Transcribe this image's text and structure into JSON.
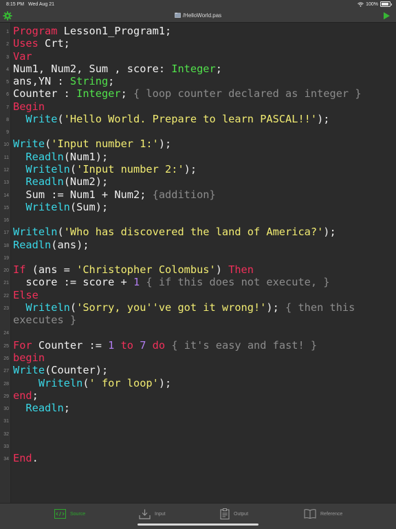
{
  "status": {
    "time": "8:15 PM",
    "date": "Wed Aug 21",
    "battery": "100%"
  },
  "toolbar": {
    "title": "/HelloWorld.pas",
    "settings_icon": "gear-icon",
    "run_icon": "play-icon"
  },
  "colors": {
    "keyword": "#f0305a",
    "function": "#3ad7e6",
    "type": "#51e14b",
    "string": "#f2ec72",
    "number": "#b07df0",
    "comment": "#8c8c8c",
    "accent": "#2ea82e"
  },
  "editor": {
    "lines": [
      {
        "n": "1",
        "segs": [
          [
            "kw",
            "Program"
          ],
          [
            "p",
            " Lesson1_Program1;"
          ]
        ]
      },
      {
        "n": "2",
        "segs": [
          [
            "kw",
            "Uses"
          ],
          [
            "p",
            " Crt;"
          ]
        ]
      },
      {
        "n": "3",
        "segs": [
          [
            "kw",
            "Var"
          ]
        ]
      },
      {
        "n": "4",
        "segs": [
          [
            "p",
            "Num1, Num2, Sum , score: "
          ],
          [
            "ty",
            "Integer"
          ],
          [
            "p",
            ";"
          ]
        ]
      },
      {
        "n": "5",
        "segs": [
          [
            "p",
            "ans,YN : "
          ],
          [
            "ty",
            "String"
          ],
          [
            "p",
            ";"
          ]
        ]
      },
      {
        "n": "6",
        "segs": [
          [
            "p",
            "Counter : "
          ],
          [
            "ty",
            "Integer"
          ],
          [
            "p",
            "; "
          ],
          [
            "cm",
            "{ loop counter declared as integer }"
          ]
        ]
      },
      {
        "n": "7",
        "segs": [
          [
            "kw",
            "Begin"
          ]
        ]
      },
      {
        "n": "8",
        "segs": [
          [
            "p",
            "  "
          ],
          [
            "fn",
            "Write"
          ],
          [
            "p",
            "("
          ],
          [
            "st",
            "'Hello World. Prepare to learn PASCAL!!'"
          ],
          [
            "p",
            ");"
          ]
        ]
      },
      {
        "n": "9",
        "segs": []
      },
      {
        "n": "10",
        "segs": [
          [
            "fn",
            "Write"
          ],
          [
            "p",
            "("
          ],
          [
            "st",
            "'Input number 1:'"
          ],
          [
            "p",
            ");"
          ]
        ]
      },
      {
        "n": "11",
        "segs": [
          [
            "p",
            "  "
          ],
          [
            "fn",
            "Readln"
          ],
          [
            "p",
            "(Num1);"
          ]
        ]
      },
      {
        "n": "12",
        "segs": [
          [
            "p",
            "  "
          ],
          [
            "fn",
            "Writeln"
          ],
          [
            "p",
            "("
          ],
          [
            "st",
            "'Input number 2:'"
          ],
          [
            "p",
            ");"
          ]
        ]
      },
      {
        "n": "13",
        "segs": [
          [
            "p",
            "  "
          ],
          [
            "fn",
            "Readln"
          ],
          [
            "p",
            "(Num2);"
          ]
        ]
      },
      {
        "n": "14",
        "segs": [
          [
            "p",
            "  Sum := Num1 + Num2; "
          ],
          [
            "cm",
            "{addition}"
          ]
        ]
      },
      {
        "n": "15",
        "segs": [
          [
            "p",
            "  "
          ],
          [
            "fn",
            "Writeln"
          ],
          [
            "p",
            "(Sum);"
          ]
        ]
      },
      {
        "n": "16",
        "segs": []
      },
      {
        "n": "17",
        "segs": [
          [
            "fn",
            "Writeln"
          ],
          [
            "p",
            "("
          ],
          [
            "st",
            "'Who has discovered the land of America?'"
          ],
          [
            "p",
            ");"
          ]
        ]
      },
      {
        "n": "18",
        "segs": [
          [
            "fn",
            "Readln"
          ],
          [
            "p",
            "(ans);"
          ]
        ]
      },
      {
        "n": "19",
        "segs": []
      },
      {
        "n": "20",
        "segs": [
          [
            "kw",
            "If"
          ],
          [
            "p",
            " (ans = "
          ],
          [
            "st",
            "'Christopher Colombus'"
          ],
          [
            "p",
            ") "
          ],
          [
            "kw",
            "Then"
          ]
        ]
      },
      {
        "n": "21",
        "segs": [
          [
            "p",
            "  score := score + "
          ],
          [
            "nm",
            "1"
          ],
          [
            "p",
            " "
          ],
          [
            "cm",
            "{ if this does not execute, }"
          ]
        ]
      },
      {
        "n": "22",
        "segs": [
          [
            "kw",
            "Else"
          ]
        ]
      },
      {
        "n": "23",
        "segs": [
          [
            "p",
            "  "
          ],
          [
            "fn",
            "Writeln"
          ],
          [
            "p",
            "("
          ],
          [
            "st",
            "'Sorry, you''ve got it wrong!'"
          ],
          [
            "p",
            "); "
          ],
          [
            "cm",
            "{ then this"
          ]
        ]
      },
      {
        "n": "",
        "segs": [
          [
            "cm",
            "executes }"
          ]
        ]
      },
      {
        "n": "24",
        "segs": []
      },
      {
        "n": "25",
        "segs": [
          [
            "kw",
            "For"
          ],
          [
            "p",
            " Counter := "
          ],
          [
            "nm",
            "1"
          ],
          [
            "p",
            " "
          ],
          [
            "kw",
            "to"
          ],
          [
            "p",
            " "
          ],
          [
            "nm",
            "7"
          ],
          [
            "p",
            " "
          ],
          [
            "kw",
            "do"
          ],
          [
            "p",
            " "
          ],
          [
            "cm",
            "{ it's easy and fast! }"
          ]
        ]
      },
      {
        "n": "26",
        "segs": [
          [
            "kw",
            "begin"
          ]
        ]
      },
      {
        "n": "27",
        "segs": [
          [
            "fn",
            "Write"
          ],
          [
            "p",
            "(Counter);"
          ]
        ]
      },
      {
        "n": "28",
        "segs": [
          [
            "p",
            "    "
          ],
          [
            "fn",
            "Writeln"
          ],
          [
            "p",
            "("
          ],
          [
            "st",
            "' for loop'"
          ],
          [
            "p",
            ");"
          ]
        ]
      },
      {
        "n": "29",
        "segs": [
          [
            "kw",
            "end"
          ],
          [
            "p",
            ";"
          ]
        ]
      },
      {
        "n": "30",
        "segs": [
          [
            "p",
            "  "
          ],
          [
            "fn",
            "Readln"
          ],
          [
            "p",
            ";"
          ]
        ]
      },
      {
        "n": "31",
        "segs": []
      },
      {
        "n": "32",
        "segs": []
      },
      {
        "n": "33",
        "segs": []
      },
      {
        "n": "34",
        "segs": [
          [
            "kw",
            "End"
          ],
          [
            "p",
            "."
          ]
        ]
      }
    ]
  },
  "tabs": [
    {
      "label": "Source",
      "icon": "code-icon",
      "active": true
    },
    {
      "label": "Input",
      "icon": "download-tray-icon",
      "active": false
    },
    {
      "label": "Output",
      "icon": "clipboard-icon",
      "active": false
    },
    {
      "label": "Reference",
      "icon": "book-icon",
      "active": false
    }
  ]
}
